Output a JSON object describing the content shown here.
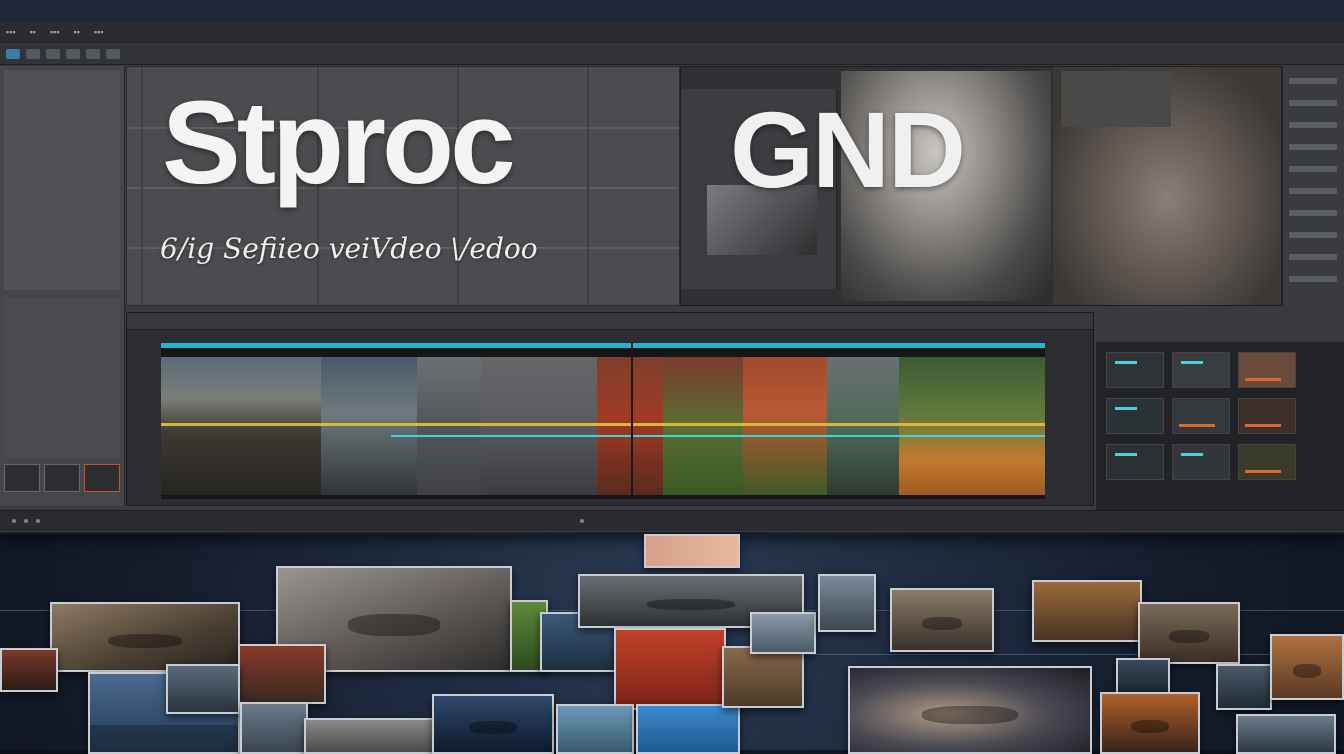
{
  "title": {
    "main": "Stproc",
    "right": "GND",
    "subtitle": "6/ig Sefiieo veiVdeo \\/edoo"
  },
  "timeline": {
    "label": "",
    "timecode": ""
  },
  "status": {
    "timecode": ""
  },
  "colors": {
    "accent_cyan": "#1fb6d6",
    "accent_yellow": "#d9b73a",
    "panel_dark": "#2c2d30",
    "panel_mid": "#3a3b3e"
  },
  "icons": {
    "toolbar": [
      "select-tool-icon",
      "razor-tool-icon",
      "hand-tool-icon",
      "zoom-tool-icon"
    ]
  }
}
